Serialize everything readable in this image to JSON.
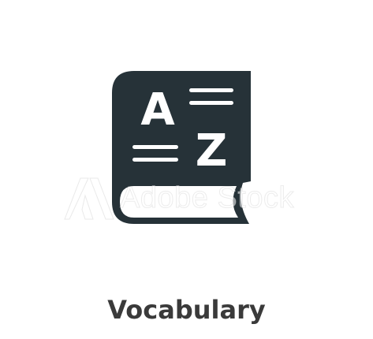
{
  "icon": {
    "name": "book-az-icon",
    "letter_top": "A",
    "letter_bottom": "Z",
    "color": "#263238"
  },
  "watermark": {
    "text": "Adobe Stock"
  },
  "caption": {
    "text": "Vocabulary",
    "color": "#3a3a3a"
  }
}
